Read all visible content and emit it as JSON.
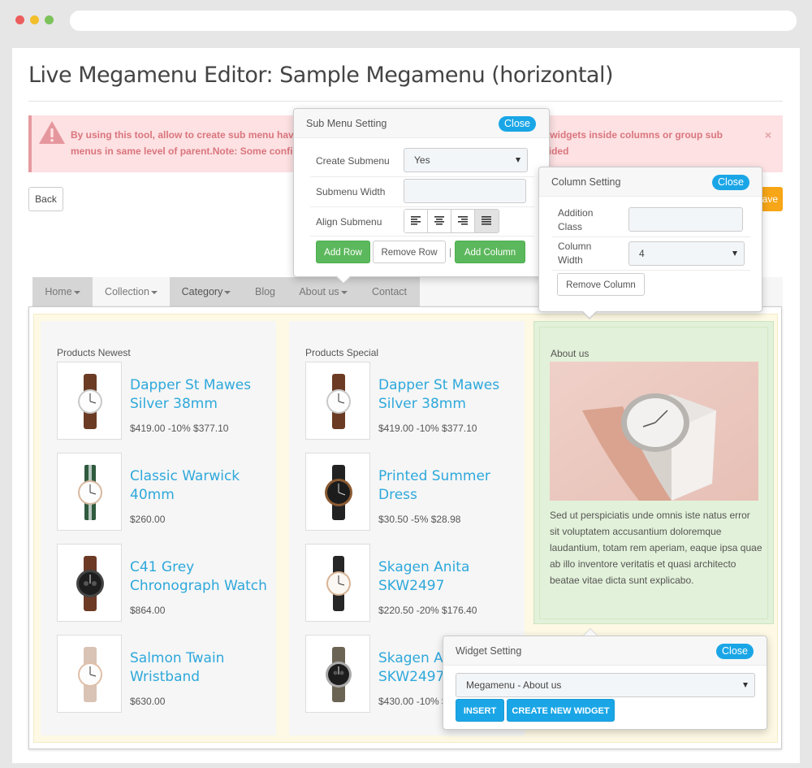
{
  "page": {
    "title": "Live Megamenu Editor: Sample Megamenu (horizontal)",
    "alert_text": "By using this tool, allow to create sub menu having multiple rows and multiple columns. You can inject widgets inside columns or group sub menus in same level of parent.Note: Some configurations as group, columns width setting will be overrided",
    "alert_close": "×",
    "back_label": "Back",
    "save_label": "ave"
  },
  "menu": {
    "items": [
      {
        "label": "Home",
        "has_caret": true
      },
      {
        "label": "Collection",
        "has_caret": true
      },
      {
        "label": "Category",
        "has_caret": true
      },
      {
        "label": "Blog",
        "has_caret": false
      },
      {
        "label": "About us",
        "has_caret": true
      },
      {
        "label": "Contact",
        "has_caret": false
      }
    ]
  },
  "columns": [
    {
      "title": "Products Newest",
      "products": [
        {
          "name": "Dapper St Mawes Silver 38mm",
          "price": "$419.00 -10% $377.10"
        },
        {
          "name": "Classic Warwick 40mm",
          "price": "$260.00"
        },
        {
          "name": "C41 Grey Chronograph Watch",
          "price": "$864.00"
        },
        {
          "name": "Salmon Twain Wristband",
          "price": "$630.00"
        }
      ]
    },
    {
      "title": "Products Special",
      "products": [
        {
          "name": "Dapper St Mawes Silver 38mm",
          "price": "$419.00 -10% $377.10"
        },
        {
          "name": "Printed Summer Dress",
          "price": "$30.50 -5% $28.98"
        },
        {
          "name": "Skagen Anita SKW2497",
          "price": "$220.50 -20% $176.40"
        },
        {
          "name": "Skagen Anita SKW2497",
          "price": "$430.00 -10% $387.00"
        }
      ]
    }
  ],
  "about": {
    "title": "About us",
    "text": "Sed ut perspiciatis unde omnis iste natus error sit voluptatem accusantium doloremque laudantium, totam rem aperiam, eaque ipsa quae ab illo inventore veritatis et quasi architecto beatae vitae dicta sunt explicabo."
  },
  "submenu_setting": {
    "title": "Sub Menu Setting",
    "close": "Close",
    "create_submenu_label": "Create Submenu",
    "create_submenu_value": "Yes",
    "submenu_width_label": "Submenu Width",
    "align_submenu_label": "Align Submenu",
    "add_row": "Add Row",
    "remove_row": "Remove Row",
    "separator": "|",
    "add_column": "Add Column"
  },
  "column_setting": {
    "title": "Column Setting",
    "close": "Close",
    "addition_class_label": "Addition Class",
    "column_width_label": "Column Width",
    "column_width_value": "4",
    "remove_column": "Remove Column"
  },
  "widget_setting": {
    "title": "Widget Setting",
    "close": "Close",
    "widget_value": "Megamenu - About us",
    "insert": "INSERT",
    "create_new_widget": "CREATE NEW WIDGET"
  },
  "colors": {
    "accent_blue": "#1aa6e6",
    "product_link": "#2ea8db",
    "green_button": "#5cb85c",
    "save_orange": "#f7a617",
    "alert_bg": "#fde1e3"
  }
}
